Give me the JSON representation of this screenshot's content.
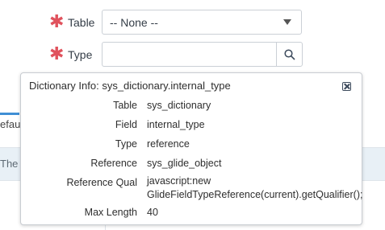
{
  "form": {
    "table": {
      "label": "Table",
      "value": "-- None --"
    },
    "type": {
      "label": "Type",
      "value": ""
    },
    "required_marker": "✱"
  },
  "background": {
    "fragment_1": "efault",
    "fragment_2": "The D"
  },
  "popup": {
    "title": "Dictionary Info: sys_dictionary.internal_type",
    "rows": [
      {
        "label": "Table",
        "value": "sys_dictionary"
      },
      {
        "label": "Field",
        "value": "internal_type"
      },
      {
        "label": "Type",
        "value": "reference"
      },
      {
        "label": "Reference",
        "value": "sys_glide_object"
      },
      {
        "label": "Reference Qual",
        "value_line1": "javascript:new",
        "value_line2": "GlideFieldTypeReference(current).getQualifier();"
      },
      {
        "label": "Max Length",
        "value": "40"
      }
    ]
  },
  "colors": {
    "required": "#e0525d",
    "accent": "#3f8fd5"
  }
}
